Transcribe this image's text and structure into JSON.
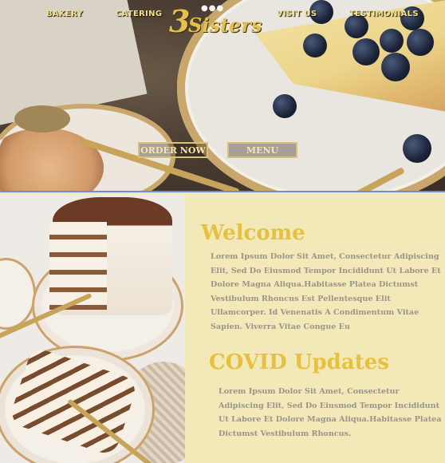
{
  "nav": {
    "bakery": "BAKERY",
    "catering": "CATERING",
    "visit": "VISIT US",
    "testimonials": "TESTIMONIALS"
  },
  "logo": {
    "number": "3",
    "word": "Sisters"
  },
  "hero": {
    "order_now": "ORDER NOW",
    "menu": "MENU"
  },
  "welcome": {
    "heading": "Welcome",
    "body": "Lorem Ipsum Dolor Sit Amet, Consectetur Adipiscing Elit, Sed Do Eiusmod Tempor Incididunt Ut Labore Et Dolore Magna Aliqua.Habitasse Platea Dictumst Vestibulum Rhoncus Est Pellentesque Elit Ullamcorper. Id Venenatis A Condimentum Vitae Sapien. Viverra Vitae Congue Eu"
  },
  "covid": {
    "heading": "COVID Updates",
    "body": "Lorem Ipsum Dolor Sit Amet, Consectetur Adipiscing Elit, Sed Do Eiusmod Tempor Incididunt Ut Labore Et Dolore Magna Aliqua.Habitasse Platea Dictumst Vestibulum Rhoncus."
  },
  "colors": {
    "accent": "#e6c13e",
    "background": "#f2e8b8",
    "body_text": "#9a958a",
    "nav_text": "#f1e08a"
  }
}
